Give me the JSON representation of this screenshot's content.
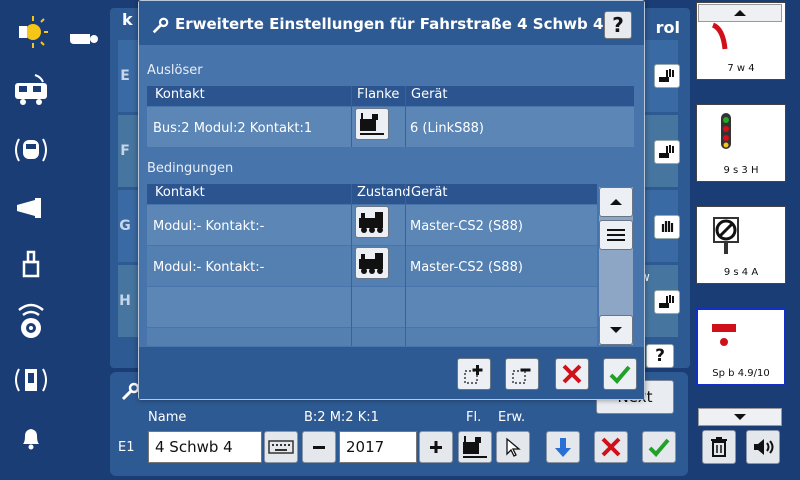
{
  "background_window": {
    "title_fragment": "k",
    "title_right_fragment": "rol",
    "row_labels": [
      "E",
      "F",
      "G",
      "H"
    ],
    "side_fragments": [
      "t",
      "w"
    ]
  },
  "dialog": {
    "title": "Erweiterte Einstellungen für Fahrstraße 4 Schwb 4",
    "help_label": "?",
    "triggers_section": "Auslöser",
    "triggers_headers": {
      "contact": "Kontakt",
      "edge": "Flanke",
      "device": "Gerät"
    },
    "triggers_rows": [
      {
        "contact": "Bus:2 Modul:2 Kontakt:1",
        "device": "6 (LinkS88)"
      }
    ],
    "conditions_section": "Bedingungen",
    "conditions_headers": {
      "contact": "Kontakt",
      "state": "Zustand",
      "device": "Gerät"
    },
    "conditions_rows": [
      {
        "contact": "Modul:- Kontakt:-",
        "device": "Master-CS2 (S88)"
      },
      {
        "contact": "Modul:- Kontakt:-",
        "device": "Master-CS2 (S88)"
      },
      {
        "contact": "",
        "device": ""
      },
      {
        "contact": "",
        "device": ""
      }
    ]
  },
  "bottom_panel": {
    "name_label": "Name",
    "address_label": "B:2 M:2 K:1",
    "fl_label": "Fl.",
    "erw_label": "Erw.",
    "row_label": "E1",
    "name_value": "4 Schwb 4",
    "number_value": "2017",
    "next_button_fragment": "Next"
  },
  "right_panel": {
    "cards": [
      {
        "caption": "7 w 4"
      },
      {
        "caption": "9 s 3 H"
      },
      {
        "caption": "9 s 4 A"
      },
      {
        "caption": "Sp b 4.9/10"
      }
    ]
  },
  "colors": {
    "app_bg": "#1b3d75",
    "panel_bg": "#2e5a93",
    "dialog_bg": "#4674ab",
    "accent_yellow": "#f5c518",
    "accept_green": "#22a12a",
    "cancel_red": "#d0101a",
    "arrow_blue": "#2a6fd6",
    "selected_border": "#1230c8"
  }
}
